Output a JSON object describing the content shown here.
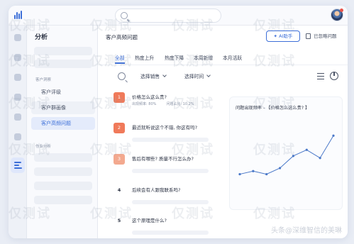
{
  "app": {
    "search_placeholder": ""
  },
  "left_panel": {
    "title": "分析",
    "groups": [
      {
        "label": "客户洞察",
        "items": [
          {
            "label": "客户评级",
            "active": false
          },
          {
            "label": "客户群画像",
            "active": false
          },
          {
            "label": "客户高频问题",
            "active": true
          }
        ]
      },
      {
        "label": "作业分析",
        "items": []
      }
    ]
  },
  "main": {
    "title": "客户高频问题",
    "ai_button": "AI助手",
    "ignored_button": "已忽略问题",
    "tabs": [
      "全部",
      "热度上升",
      "热度下降",
      "本周新增",
      "本月活跃"
    ],
    "active_tab": 0,
    "filters": {
      "sales": "选择销售",
      "time": "选择时间"
    },
    "questions": [
      {
        "rank": "1",
        "text": "价格怎么这么贵?",
        "meta": [
          "出现频率: 80%",
          "问题占比: 10.2%"
        ]
      },
      {
        "rank": "2",
        "text": "最近就听说这个不错, 你这有吗?",
        "meta": []
      },
      {
        "rank": "3",
        "text": "售后有哪些? 质量不行怎么办?",
        "meta": []
      },
      {
        "rank": "4",
        "text": "后续会有人跟我联系吗?",
        "meta": []
      },
      {
        "rank": "5",
        "text": "这个原理是什么?",
        "meta": []
      }
    ]
  },
  "chart_data": {
    "type": "line",
    "title": "问题出现频率 - 【价格怎么这么贵? 】",
    "x": [
      1,
      2,
      3,
      4,
      5,
      6,
      7,
      8
    ],
    "series": [
      {
        "values": [
          22,
          25,
          22,
          28,
          40,
          46,
          38,
          60
        ],
        "color": "#4a78c8"
      }
    ],
    "ylim": [
      0,
      70
    ],
    "grid": false,
    "xlabel": "",
    "ylabel": ""
  },
  "watermark": {
    "text": "仅测试",
    "brand": "头条@深维智信的美琳"
  },
  "colors": {
    "accent": "#3d6fd8",
    "hot": "#f07a5a",
    "line": "#4a78c8"
  }
}
